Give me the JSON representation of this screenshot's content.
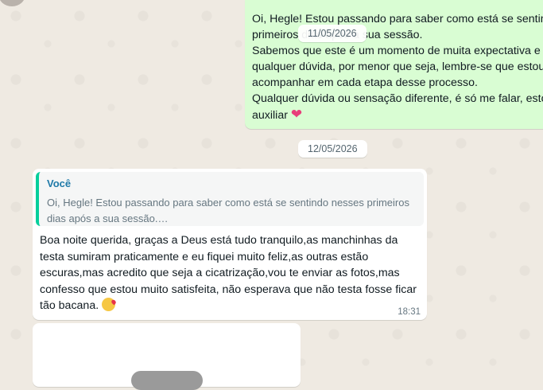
{
  "outgoing_message": {
    "text": "Oi, Hegle! Estou passando para saber como está se sentin\nprimeiros dias após a sua sessão.\nSabemos que este é um momento de muita expectativa e\nqualquer dúvida, por menor que seja, lembre-se que estou\nacompanhar em cada etapa desse processo.\nQualquer dúvida ou sensação diferente, é só me falar, esto\nauxiliar",
    "emoji": "heart"
  },
  "date_chips": [
    "11/05/2026",
    "12/05/2026"
  ],
  "incoming_message": {
    "quote_author": "Você",
    "quote_text": "Oi, Hegle! Estou passando para saber como está se sentindo nesses primeiros dias após a sua sessão.…",
    "text": "Boa noite querida, graças a Deus está tudo tranquilo,as manchinhas da testa sumiram praticamente e eu fiquei muito feliz,as outras estão escuras,mas acredito que seja a cicatrização,vou te enviar as fotos,mas confesso que estou muito satisfeita, não esperava que não testa fosse ficar tão bacana.",
    "emoji": "face-blowing-kiss",
    "time": "18:31"
  },
  "colors": {
    "chat_background": "#efeae2",
    "outgoing_bubble": "#d9fdd3",
    "quote_bar": "#06cf9c",
    "quote_author": "#1f7aa8"
  }
}
